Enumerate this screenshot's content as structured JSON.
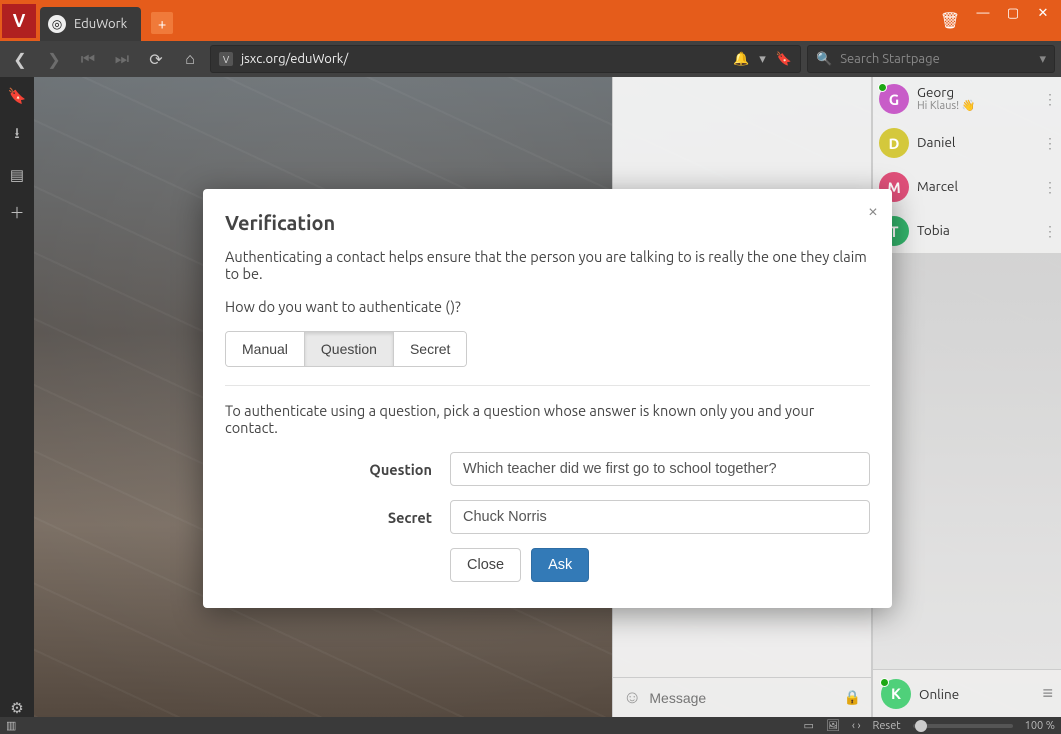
{
  "browser": {
    "app_logo_letter": "V",
    "tab_title": "EduWork",
    "url": "jsxc.org/eduWork/",
    "search_placeholder": "Search Startpage"
  },
  "roster": {
    "contacts": [
      {
        "name": "Georg",
        "sub": "Hi Klaus! 👋",
        "initial": "G",
        "color": "#c85cc8",
        "online": true
      },
      {
        "name": "Daniel",
        "sub": "",
        "initial": "D",
        "color": "#d4c83c",
        "online": false
      },
      {
        "name": "Marcel",
        "sub": "",
        "initial": "M",
        "color": "#e0507a",
        "online": false
      },
      {
        "name": "Tobia",
        "sub": "",
        "initial": "T",
        "color": "#33b36b",
        "online": false
      }
    ],
    "me": {
      "initial": "K",
      "color": "#4fd07a",
      "status": "Online"
    }
  },
  "chat": {
    "message_placeholder": "Message"
  },
  "modal": {
    "title": "Verification",
    "intro": "Authenticating a contact helps ensure that the person you are talking to is really the one they claim to be.",
    "how": "How do you want to authenticate ()?",
    "tabs": {
      "manual": "Manual",
      "question": "Question",
      "secret": "Secret"
    },
    "question_help": "To authenticate using a question, pick a question whose answer is known only you and your contact.",
    "labels": {
      "question": "Question",
      "secret": "Secret"
    },
    "values": {
      "question": "Which teacher did we first go to school together?",
      "secret": "Chuck Norris"
    },
    "buttons": {
      "close": "Close",
      "ask": "Ask"
    }
  },
  "statusbar": {
    "reset": "Reset",
    "zoom": "100 %"
  }
}
